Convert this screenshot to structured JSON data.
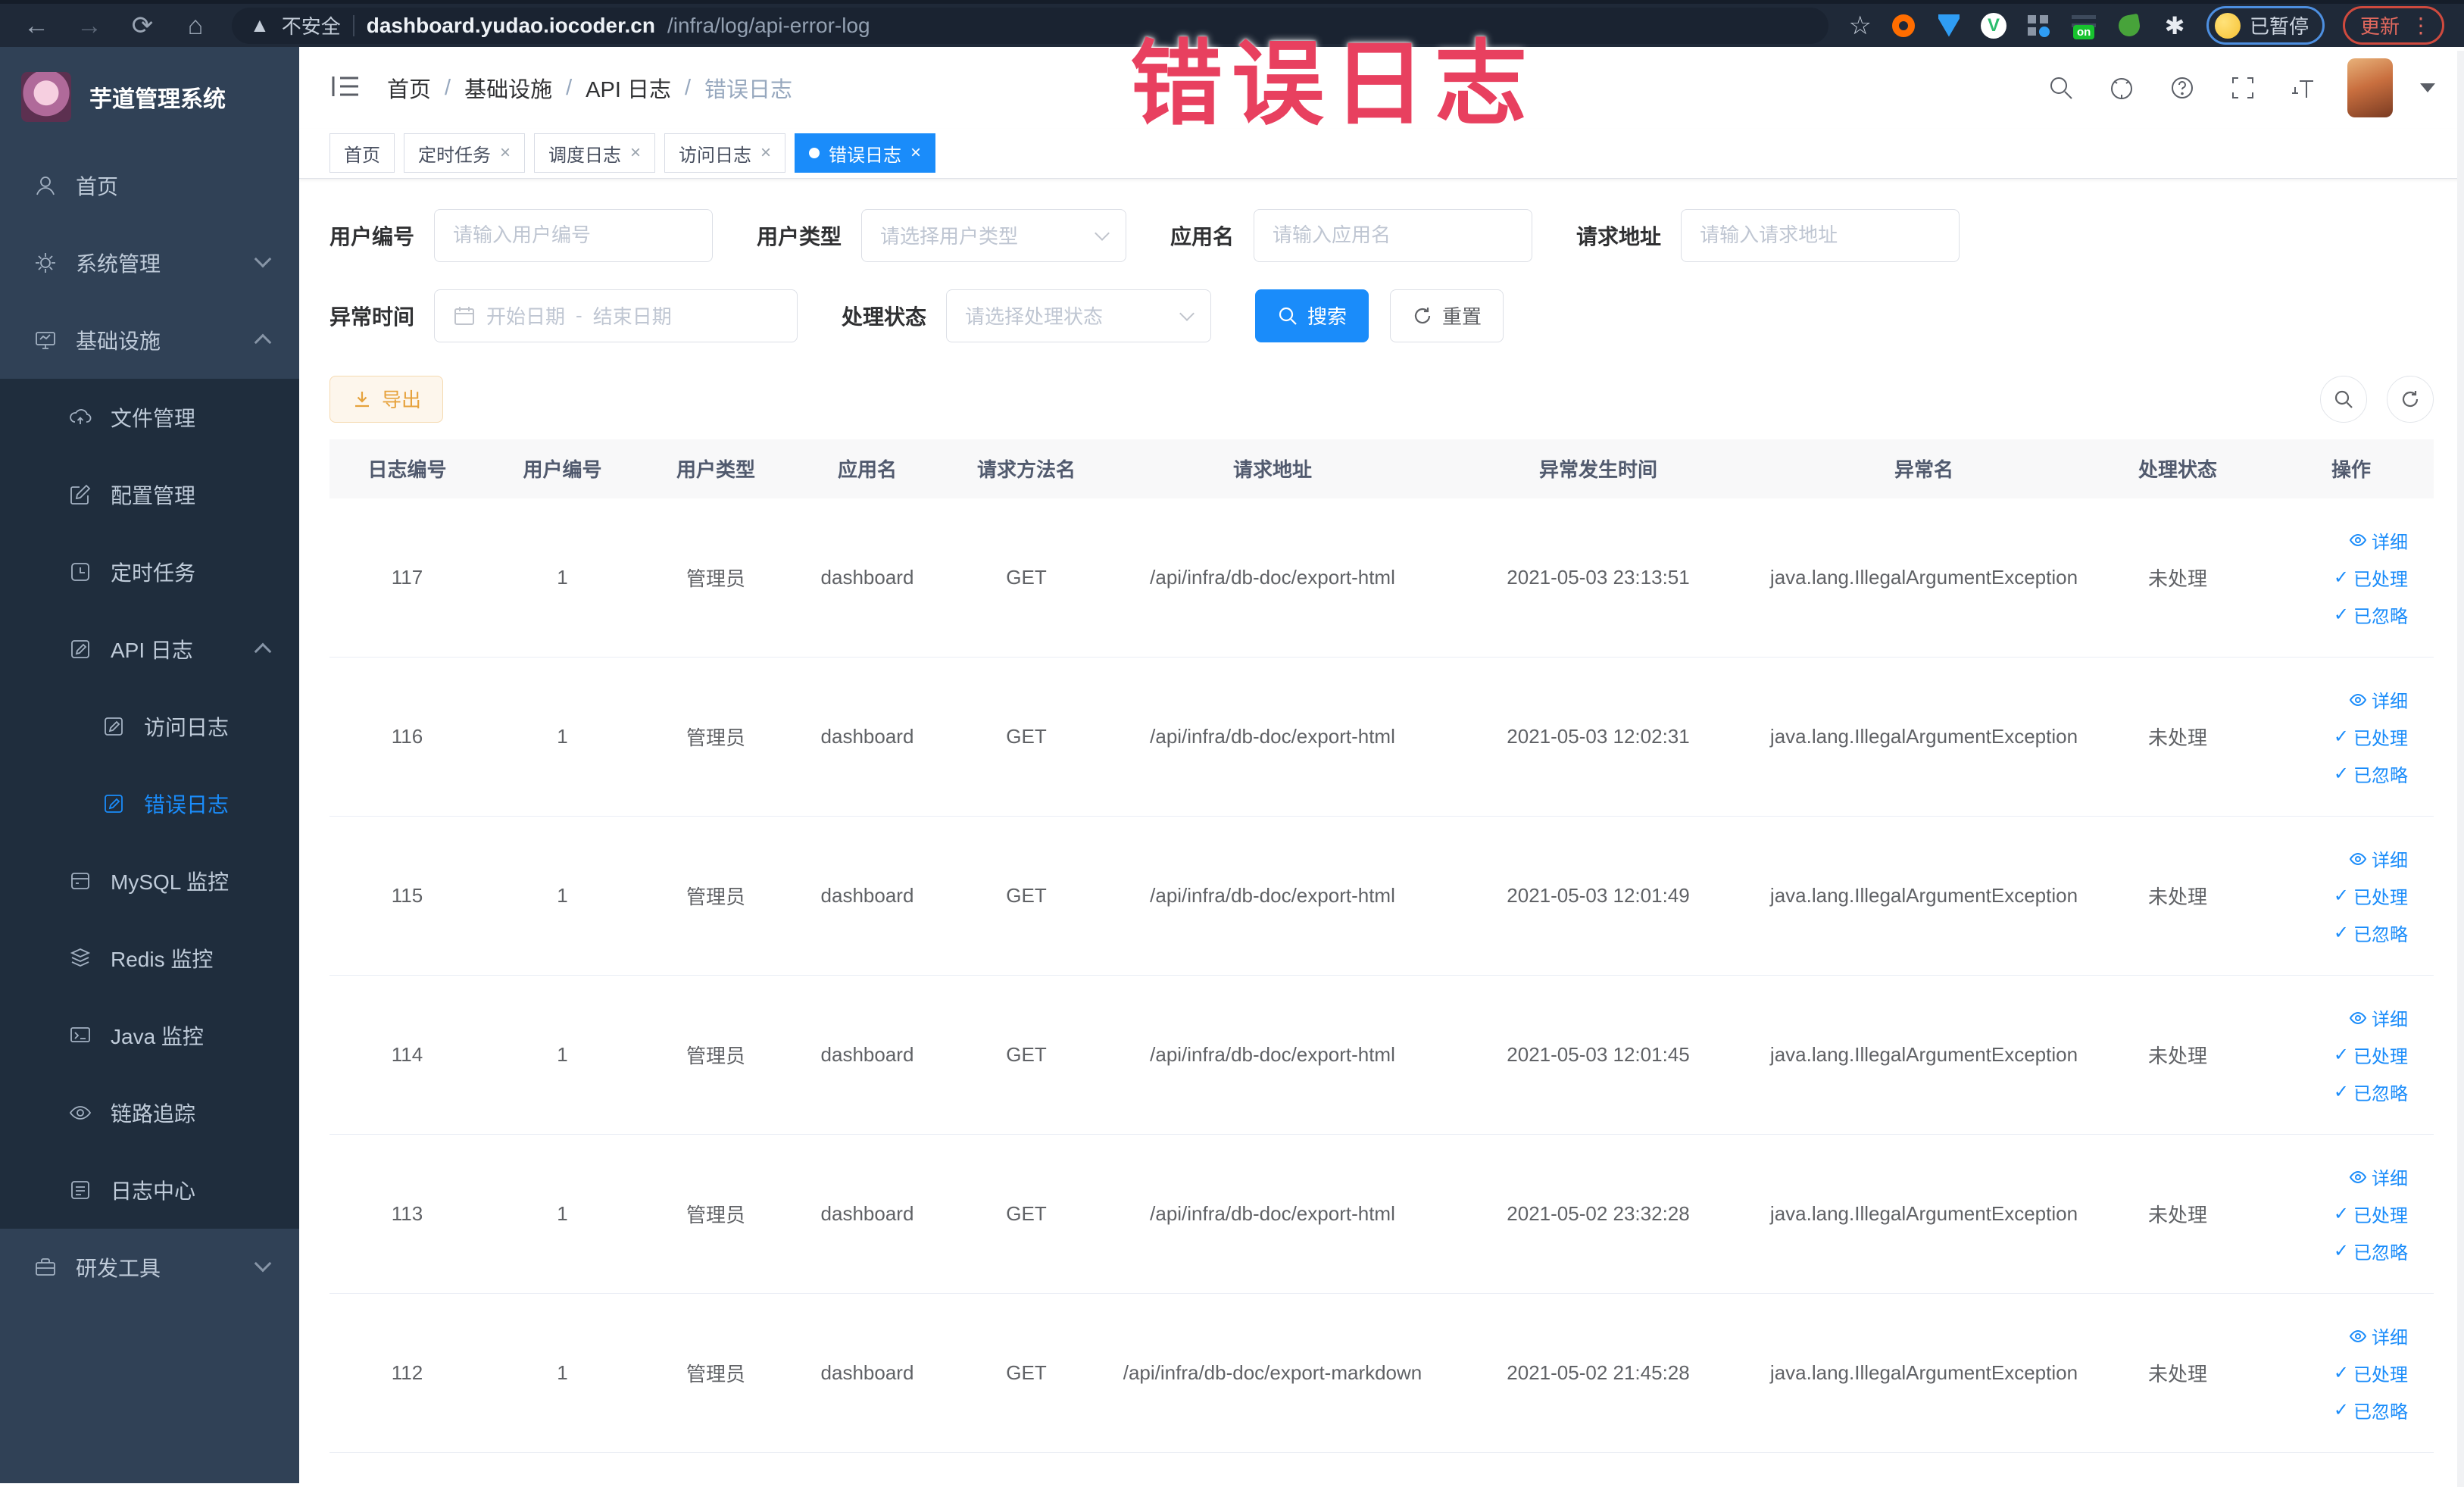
{
  "overlay": {
    "watermark": "错误日志"
  },
  "browser": {
    "security_label": "不安全",
    "url_host": "dashboard.yudao.iocoder.cn",
    "url_path": "/infra/log/api-error-log",
    "paused_badge": "已暂停",
    "update_label": "更新",
    "extension_on_badge": "on",
    "extension_v_label": "V"
  },
  "sidebar": {
    "app_title": "芋道管理系统",
    "items": [
      {
        "label": "首页"
      },
      {
        "label": "系统管理"
      },
      {
        "label": "基础设施"
      },
      {
        "label": "文件管理"
      },
      {
        "label": "配置管理"
      },
      {
        "label": "定时任务"
      },
      {
        "label": "API 日志"
      },
      {
        "label": "访问日志"
      },
      {
        "label": "错误日志"
      },
      {
        "label": "MySQL 监控"
      },
      {
        "label": "Redis 监控"
      },
      {
        "label": "Java 监控"
      },
      {
        "label": "链路追踪"
      },
      {
        "label": "日志中心"
      },
      {
        "label": "研发工具"
      }
    ]
  },
  "header": {
    "breadcrumbs": [
      "首页",
      "基础设施",
      "API 日志",
      "错误日志"
    ],
    "separator": "/"
  },
  "tabs": [
    {
      "label": "首页"
    },
    {
      "label": "定时任务"
    },
    {
      "label": "调度日志"
    },
    {
      "label": "访问日志"
    },
    {
      "label": "错误日志"
    }
  ],
  "filters": {
    "user_id_label": "用户编号",
    "user_id_placeholder": "请输入用户编号",
    "user_type_label": "用户类型",
    "user_type_placeholder": "请选择用户类型",
    "app_name_label": "应用名",
    "app_name_placeholder": "请输入应用名",
    "request_url_label": "请求地址",
    "request_url_placeholder": "请输入请求地址",
    "exception_time_label": "异常时间",
    "date_start_placeholder": "开始日期",
    "date_separator": "-",
    "date_end_placeholder": "结束日期",
    "process_status_label": "处理状态",
    "process_status_placeholder": "请选择处理状态",
    "search_label": "搜索",
    "reset_label": "重置"
  },
  "toolbar": {
    "export_label": "导出"
  },
  "table": {
    "columns": [
      "日志编号",
      "用户编号",
      "用户类型",
      "应用名",
      "请求方法名",
      "请求地址",
      "异常发生时间",
      "异常名",
      "处理状态",
      "操作"
    ],
    "actions": [
      "详细",
      "已处理",
      "已忽略"
    ],
    "rows": [
      {
        "id": "117",
        "user_id": "1",
        "user_type": "管理员",
        "app": "dashboard",
        "method": "GET",
        "url": "/api/infra/db-doc/export-html",
        "time": "2021-05-03 23:13:51",
        "exception": "java.lang.IllegalArgumentException",
        "status": "未处理"
      },
      {
        "id": "116",
        "user_id": "1",
        "user_type": "管理员",
        "app": "dashboard",
        "method": "GET",
        "url": "/api/infra/db-doc/export-html",
        "time": "2021-05-03 12:02:31",
        "exception": "java.lang.IllegalArgumentException",
        "status": "未处理"
      },
      {
        "id": "115",
        "user_id": "1",
        "user_type": "管理员",
        "app": "dashboard",
        "method": "GET",
        "url": "/api/infra/db-doc/export-html",
        "time": "2021-05-03 12:01:49",
        "exception": "java.lang.IllegalArgumentException",
        "status": "未处理"
      },
      {
        "id": "114",
        "user_id": "1",
        "user_type": "管理员",
        "app": "dashboard",
        "method": "GET",
        "url": "/api/infra/db-doc/export-html",
        "time": "2021-05-03 12:01:45",
        "exception": "java.lang.IllegalArgumentException",
        "status": "未处理"
      },
      {
        "id": "113",
        "user_id": "1",
        "user_type": "管理员",
        "app": "dashboard",
        "method": "GET",
        "url": "/api/infra/db-doc/export-html",
        "time": "2021-05-02 23:32:28",
        "exception": "java.lang.IllegalArgumentException",
        "status": "未处理"
      },
      {
        "id": "112",
        "user_id": "1",
        "user_type": "管理员",
        "app": "dashboard",
        "method": "GET",
        "url": "/api/infra/db-doc/export-markdown",
        "time": "2021-05-02 21:45:28",
        "exception": "java.lang.IllegalArgumentException",
        "status": "未处理"
      }
    ]
  },
  "colors": {
    "accent_blue": "#1a8cfa",
    "sidebar_bg": "#304156",
    "submenu_bg": "#1f2d3d",
    "warning_bg": "#fdf6ec",
    "warning_border": "#f5dab1",
    "warning_text": "#e6a23c",
    "watermark_red": "#e8405f",
    "browser_bar_bg": "#1f2938"
  }
}
